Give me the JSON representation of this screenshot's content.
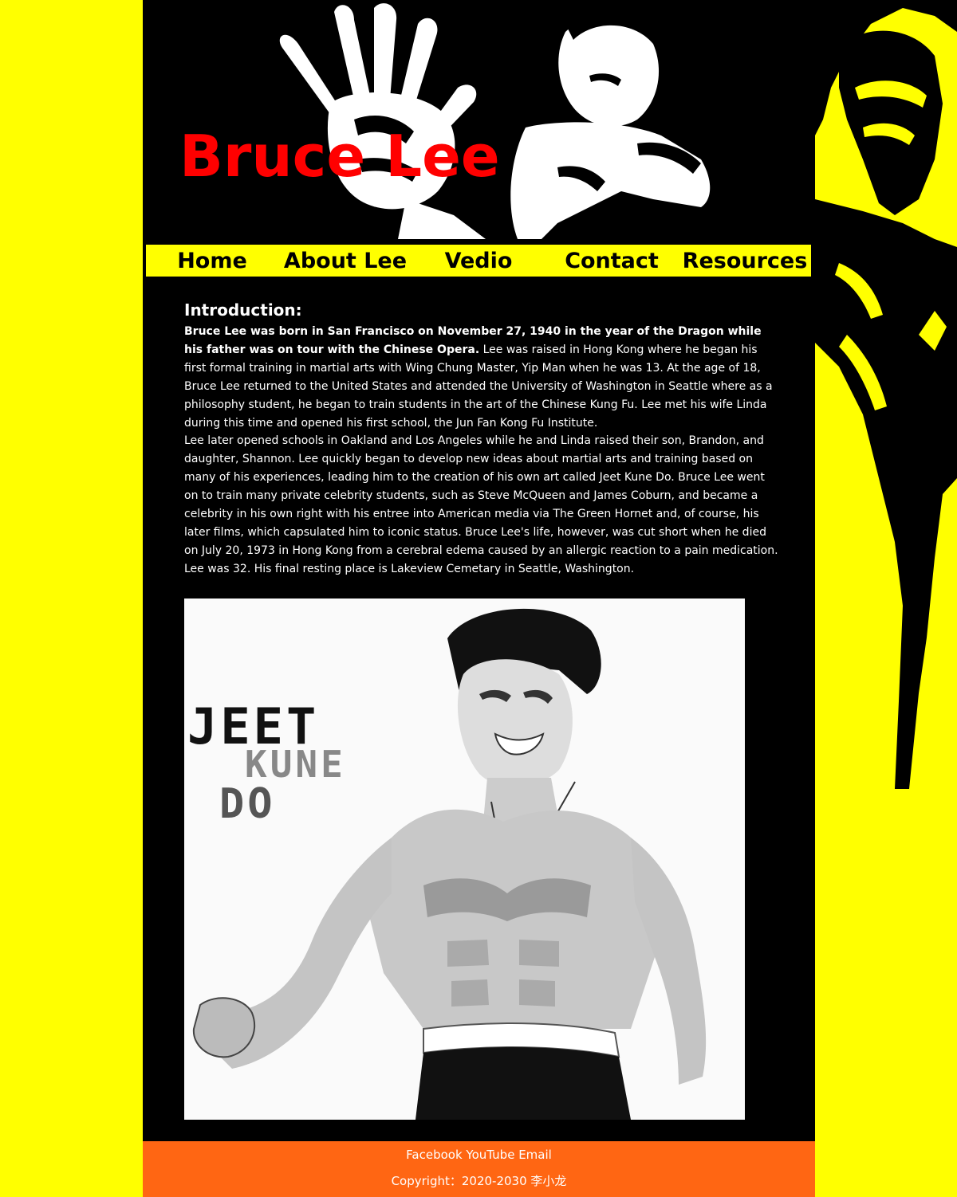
{
  "header": {
    "title": "Bruce Lee"
  },
  "nav": {
    "items": [
      {
        "label": "Home"
      },
      {
        "label": "About Lee"
      },
      {
        "label": "Vedio"
      },
      {
        "label": "Contact"
      },
      {
        "label": "Resources"
      }
    ]
  },
  "intro": {
    "heading": "Introduction:",
    "lead_bold": "Bruce Lee was born in San Francisco on November 27, 1940 in the year of the Dragon while his father was on tour with the Chinese Opera.",
    "lead_rest": " Lee was raised in Hong Kong where he began his first formal training in martial arts with Wing Chung Master, Yip Man when he was 13. At the age of 18, Bruce Lee returned to the United States and attended the University of Washington in Seattle where as a philosophy student, he began to train students in the art of the Chinese Kung Fu. Lee met his wife Linda during this time and opened his first school, the Jun Fan Kong Fu Institute.",
    "paragraph2": "Lee later opened schools in Oakland and Los Angeles while he and Linda raised their son, Brandon, and daughter, Shannon. Lee quickly began to develop new ideas about martial arts and training based on many of his experiences, leading him to the creation of his own art called Jeet Kune Do. Bruce Lee went on to train many private celebrity students, such as Steve McQueen and James Coburn, and became a celebrity in his own right with his entree into American media via The Green Hornet and, of course, his later films, which capsulated him to iconic status. Bruce Lee's life, however, was cut short when he died on July 20, 1973 in Hong Kong from a cerebral edema caused by an allergic reaction to a pain medication. Lee was 32. His final resting place is Lakeview Cemetary in Seattle, Washington."
  },
  "photo": {
    "line1": "JEET",
    "line2": "KUNE",
    "line3": "DO"
  },
  "footer": {
    "links": [
      {
        "label": "Facebook"
      },
      {
        "label": "YouTube"
      },
      {
        "label": "Email"
      }
    ],
    "copyright": "Copyright：2020-2030 李小龙"
  },
  "colors": {
    "page_bg": "#ffff00",
    "content_bg": "#000000",
    "title": "#ff0000",
    "nav_bg": "#ffff00",
    "footer_bg": "#ff6613"
  }
}
